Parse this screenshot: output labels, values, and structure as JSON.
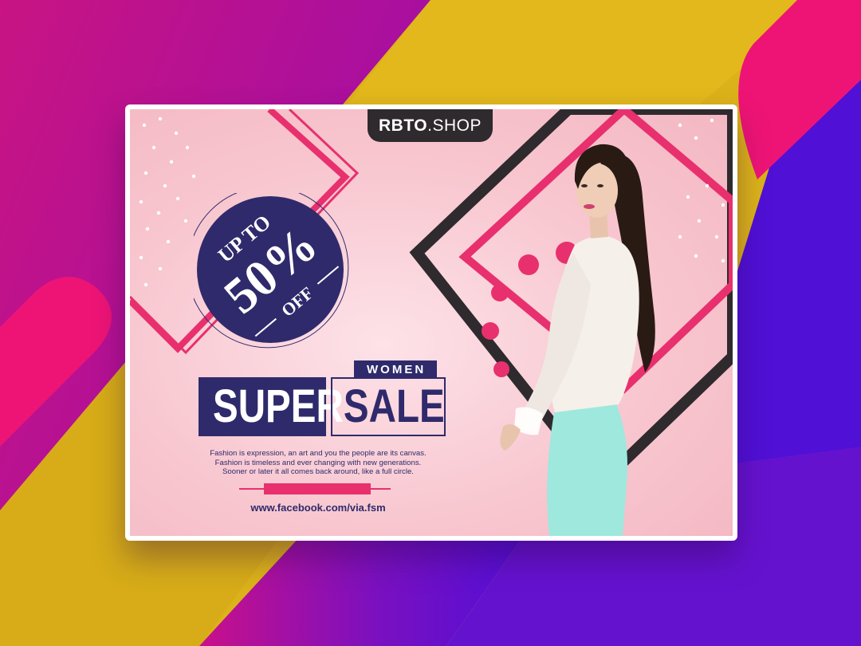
{
  "brand": {
    "name_bold": "RBTO",
    "name_light": ".SHOP"
  },
  "badge": {
    "line1": "UP TO",
    "line2": "50%",
    "line3": "OFF"
  },
  "headline": {
    "tag": "WOMEN",
    "word1": "SUPER",
    "word2": "SALE"
  },
  "description": [
    "Fashion is expression, an art and you the people are its canvas.",
    "Fashion is timeless and ever changing with new generations.",
    "Sooner or later it all comes back around, like a full circle."
  ],
  "website": "www.facebook.com/via.fsm",
  "colors": {
    "navy": "#2f2a6b",
    "pink": "#e8306e",
    "dark": "#2f2a2d",
    "card_bg": "#f8c6cf",
    "magenta": "#d0127f",
    "yellow": "#f0b600",
    "purple": "#4a12d8"
  },
  "icons": [
    "model-photo",
    "decorative-dots",
    "diamond-frames"
  ]
}
